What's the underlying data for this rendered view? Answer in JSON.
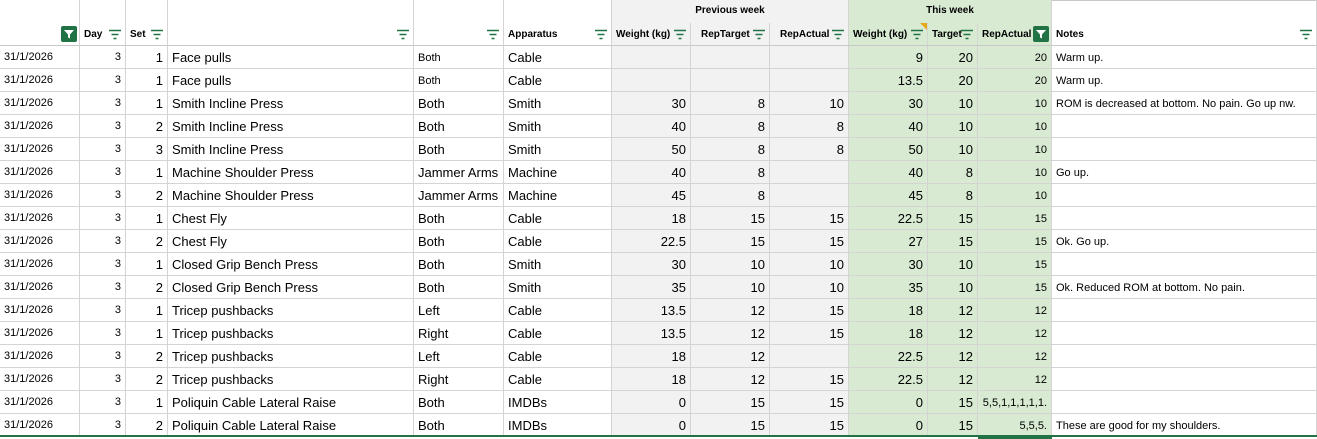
{
  "header_groups": {
    "previous_week": "Previous week",
    "this_week": "This week"
  },
  "columns": {
    "day": "Day",
    "set": "Set",
    "apparatus": "Apparatus",
    "prev_weight": "Weight (kg)",
    "prev_reptarget": "RepTarget",
    "prev_repactual": "RepActual",
    "this_weight": "Weight (kg)",
    "this_target": "Target",
    "this_repactual": "RepActual",
    "notes": "Notes"
  },
  "filter_state": {
    "date_column_active": true,
    "this_repactual_active": true
  },
  "colors": {
    "accent": "#217346",
    "previous_week_bg": "#f2f2f2",
    "this_week_bg": "#d9ead3"
  },
  "rows": [
    {
      "date": "31/1/2026",
      "day": "3",
      "set": "1",
      "exercise": "Face pulls",
      "side": "Both",
      "apparatus": "Cable",
      "prev_weight": "",
      "prev_reptarget": "",
      "prev_repactual": "",
      "this_weight": "9",
      "this_target": "20",
      "this_repactual": "20",
      "notes": "Warm up."
    },
    {
      "date": "31/1/2026",
      "day": "3",
      "set": "1",
      "exercise": "Face pulls",
      "side": "Both",
      "apparatus": "Cable",
      "prev_weight": "",
      "prev_reptarget": "",
      "prev_repactual": "",
      "this_weight": "13.5",
      "this_target": "20",
      "this_repactual": "20",
      "notes": "Warm up."
    },
    {
      "date": "31/1/2026",
      "day": "3",
      "set": "1",
      "exercise": "Smith Incline Press",
      "side": "Both",
      "apparatus": "Smith",
      "prev_weight": "30",
      "prev_reptarget": "8",
      "prev_repactual": "10",
      "this_weight": "30",
      "this_target": "10",
      "this_repactual": "10",
      "notes": "ROM is decreased at bottom. No pain. Go up nw."
    },
    {
      "date": "31/1/2026",
      "day": "3",
      "set": "2",
      "exercise": "Smith Incline Press",
      "side": "Both",
      "apparatus": "Smith",
      "prev_weight": "40",
      "prev_reptarget": "8",
      "prev_repactual": "8",
      "this_weight": "40",
      "this_target": "10",
      "this_repactual": "10",
      "notes": ""
    },
    {
      "date": "31/1/2026",
      "day": "3",
      "set": "3",
      "exercise": "Smith Incline Press",
      "side": "Both",
      "apparatus": "Smith",
      "prev_weight": "50",
      "prev_reptarget": "8",
      "prev_repactual": "8",
      "this_weight": "50",
      "this_target": "10",
      "this_repactual": "10",
      "notes": ""
    },
    {
      "date": "31/1/2026",
      "day": "3",
      "set": "1",
      "exercise": "Machine Shoulder Press",
      "side": "Jammer Arms",
      "apparatus": "Machine",
      "prev_weight": "40",
      "prev_reptarget": "8",
      "prev_repactual": "",
      "this_weight": "40",
      "this_target": "8",
      "this_repactual": "10",
      "notes": "Go up."
    },
    {
      "date": "31/1/2026",
      "day": "3",
      "set": "2",
      "exercise": "Machine Shoulder Press",
      "side": "Jammer Arms",
      "apparatus": "Machine",
      "prev_weight": "45",
      "prev_reptarget": "8",
      "prev_repactual": "",
      "this_weight": "45",
      "this_target": "8",
      "this_repactual": "10",
      "notes": ""
    },
    {
      "date": "31/1/2026",
      "day": "3",
      "set": "1",
      "exercise": "Chest Fly",
      "side": "Both",
      "apparatus": "Cable",
      "prev_weight": "18",
      "prev_reptarget": "15",
      "prev_repactual": "15",
      "this_weight": "22.5",
      "this_target": "15",
      "this_repactual": "15",
      "notes": ""
    },
    {
      "date": "31/1/2026",
      "day": "3",
      "set": "2",
      "exercise": "Chest Fly",
      "side": "Both",
      "apparatus": "Cable",
      "prev_weight": "22.5",
      "prev_reptarget": "15",
      "prev_repactual": "15",
      "this_weight": "27",
      "this_target": "15",
      "this_repactual": "15",
      "notes": "Ok. Go up."
    },
    {
      "date": "31/1/2026",
      "day": "3",
      "set": "1",
      "exercise": "Closed Grip Bench Press",
      "side": "Both",
      "apparatus": "Smith",
      "prev_weight": "30",
      "prev_reptarget": "10",
      "prev_repactual": "10",
      "this_weight": "30",
      "this_target": "10",
      "this_repactual": "15",
      "notes": ""
    },
    {
      "date": "31/1/2026",
      "day": "3",
      "set": "2",
      "exercise": "Closed Grip Bench Press",
      "side": "Both",
      "apparatus": "Smith",
      "prev_weight": "35",
      "prev_reptarget": "10",
      "prev_repactual": "10",
      "this_weight": "35",
      "this_target": "10",
      "this_repactual": "15",
      "notes": "Ok. Reduced ROM at bottom. No pain."
    },
    {
      "date": "31/1/2026",
      "day": "3",
      "set": "1",
      "exercise": "Tricep pushbacks",
      "side": "Left",
      "apparatus": "Cable",
      "prev_weight": "13.5",
      "prev_reptarget": "12",
      "prev_repactual": "15",
      "this_weight": "18",
      "this_target": "12",
      "this_repactual": "12",
      "notes": ""
    },
    {
      "date": "31/1/2026",
      "day": "3",
      "set": "1",
      "exercise": "Tricep pushbacks",
      "side": "Right",
      "apparatus": "Cable",
      "prev_weight": "13.5",
      "prev_reptarget": "12",
      "prev_repactual": "15",
      "this_weight": "18",
      "this_target": "12",
      "this_repactual": "12",
      "notes": ""
    },
    {
      "date": "31/1/2026",
      "day": "3",
      "set": "2",
      "exercise": "Tricep pushbacks",
      "side": "Left",
      "apparatus": "Cable",
      "prev_weight": "18",
      "prev_reptarget": "12",
      "prev_repactual": "",
      "this_weight": "22.5",
      "this_target": "12",
      "this_repactual": "12",
      "notes": ""
    },
    {
      "date": "31/1/2026",
      "day": "3",
      "set": "2",
      "exercise": "Tricep pushbacks",
      "side": "Right",
      "apparatus": "Cable",
      "prev_weight": "18",
      "prev_reptarget": "12",
      "prev_repactual": "15",
      "this_weight": "22.5",
      "this_target": "12",
      "this_repactual": "12",
      "notes": ""
    },
    {
      "date": "31/1/2026",
      "day": "3",
      "set": "1",
      "exercise": "Poliquin Cable Lateral Raise",
      "side": "Both",
      "apparatus": "IMDBs",
      "prev_weight": "0",
      "prev_reptarget": "15",
      "prev_repactual": "15",
      "this_weight": "0",
      "this_target": "15",
      "this_repactual": "5,5,1,1,1,1,1.",
      "notes": ""
    },
    {
      "date": "31/1/2026",
      "day": "3",
      "set": "2",
      "exercise": "Poliquin Cable Lateral Raise",
      "side": "Both",
      "apparatus": "IMDBs",
      "prev_weight": "0",
      "prev_reptarget": "15",
      "prev_repactual": "15",
      "this_weight": "0",
      "this_target": "15",
      "this_repactual": "5,5,5.",
      "notes": "These are good for my shoulders."
    }
  ]
}
